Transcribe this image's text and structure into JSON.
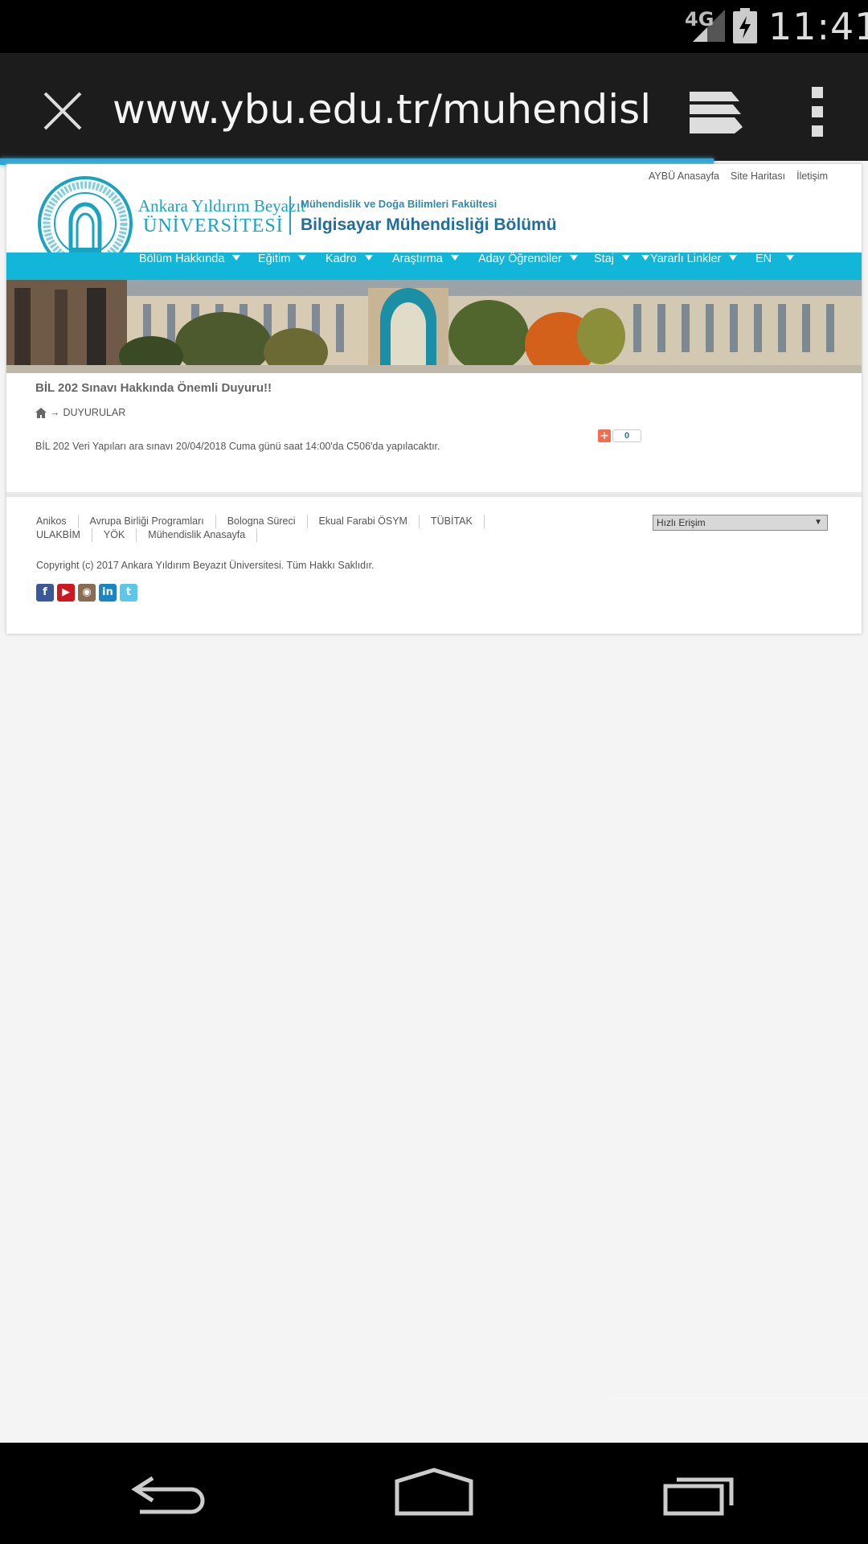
{
  "status_bar": {
    "network": "4G",
    "time": "11:41",
    "icons": [
      "signal-icon",
      "battery-charging-icon"
    ]
  },
  "browser": {
    "url": "www.ybu.edu.tr/muhendislik/bi",
    "icons": [
      "close-icon",
      "tabs-icon",
      "overflow-menu-icon"
    ]
  },
  "site": {
    "logo_line1": "Ankara Yıldırım Beyazıt",
    "logo_line2": "ÜNİVERSİTESİ",
    "faculty": "Mühendislik ve Doğa Bilimleri Fakültesi",
    "department": "Bilgisayar Mühendisliği Bölümü",
    "top_links": [
      "AYBÜ Anasayfa",
      "Site Haritası",
      "İletişim"
    ],
    "nav": [
      "Bölüm Hakkında",
      "Eğitim",
      "Kadro",
      "Araştırma",
      "Aday Öğrenciler",
      "Staj",
      "Yararlı Linkler",
      "EN"
    ]
  },
  "article": {
    "title": "BİL 202 Sınavı Hakkında Önemli Duyuru!!",
    "breadcrumb": "DUYURULAR",
    "body": "BİL 202 Veri Yapıları ara sınavı 20/04/2018 Cuma günü saat 14:00'da C506'da yapılacaktır.",
    "share_count": "0"
  },
  "footer": {
    "links": [
      "Anikos",
      "Avrupa Birliği Programları",
      "Bologna Süreci",
      "Ekual Farabi ÖSYM",
      "TÜBİTAK",
      "ULAKBİM",
      "YÖK",
      "Mühendislik Anasayfa"
    ],
    "quick_access": "Hızlı Erişim",
    "copyright": "Copyright (c) 2017 Ankara Yıldırım Beyazıt Üniversitesi. Tüm Hakkı Saklıdır.",
    "social": [
      "facebook-icon",
      "youtube-icon",
      "instagram-icon",
      "linkedin-icon",
      "twitter-icon"
    ]
  },
  "colors": {
    "nav": "#11b6d8",
    "accent": "#19a3c2",
    "progress": "#2aa7da"
  }
}
